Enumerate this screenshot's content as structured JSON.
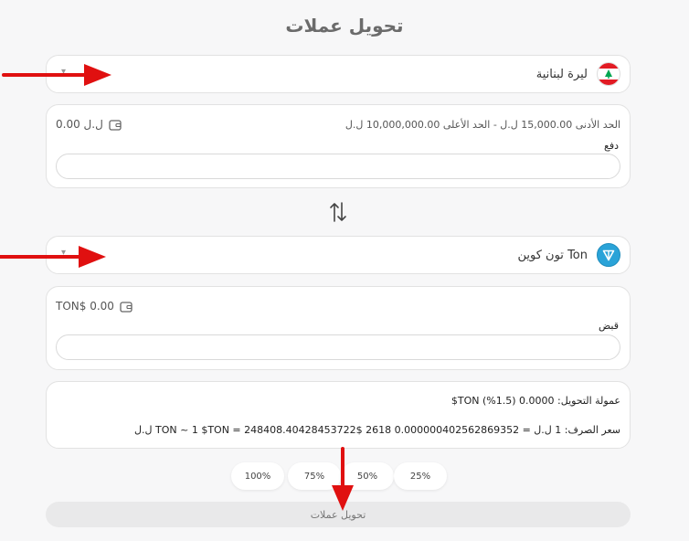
{
  "page": {
    "title": "تحويل عملات"
  },
  "from": {
    "currency_name": "ليرة لبنانية",
    "balance": "0.00 ل.ل",
    "limits": "الحد الأدنى 15,000.00 ل.ل   -   الحد الأعلى 10,000,000.00 ل.ل",
    "input_label": "دفع",
    "input_value": ""
  },
  "to": {
    "currency_name": "Ton تون كوين",
    "balance": "TON$ 0.00",
    "input_label": "قبض",
    "input_value": ""
  },
  "info": {
    "fee": "عمولة التحويل: 0.0000 (1.5%) TON$",
    "rate": "سعر الصرف: 1 ل.ل = 0.000000402562869352 2618 $TON ~ 1 $TON = 248408.40428453722 ل.ل"
  },
  "percent_buttons": [
    "100%",
    "75%",
    "50%",
    "25%"
  ],
  "submit_label": "تحويل عملات",
  "colors": {
    "accent": "#2aa3d8",
    "annotation_arrow": "#e01010",
    "lebanon_red": "#e21b24",
    "lebanon_green": "#00a651"
  }
}
